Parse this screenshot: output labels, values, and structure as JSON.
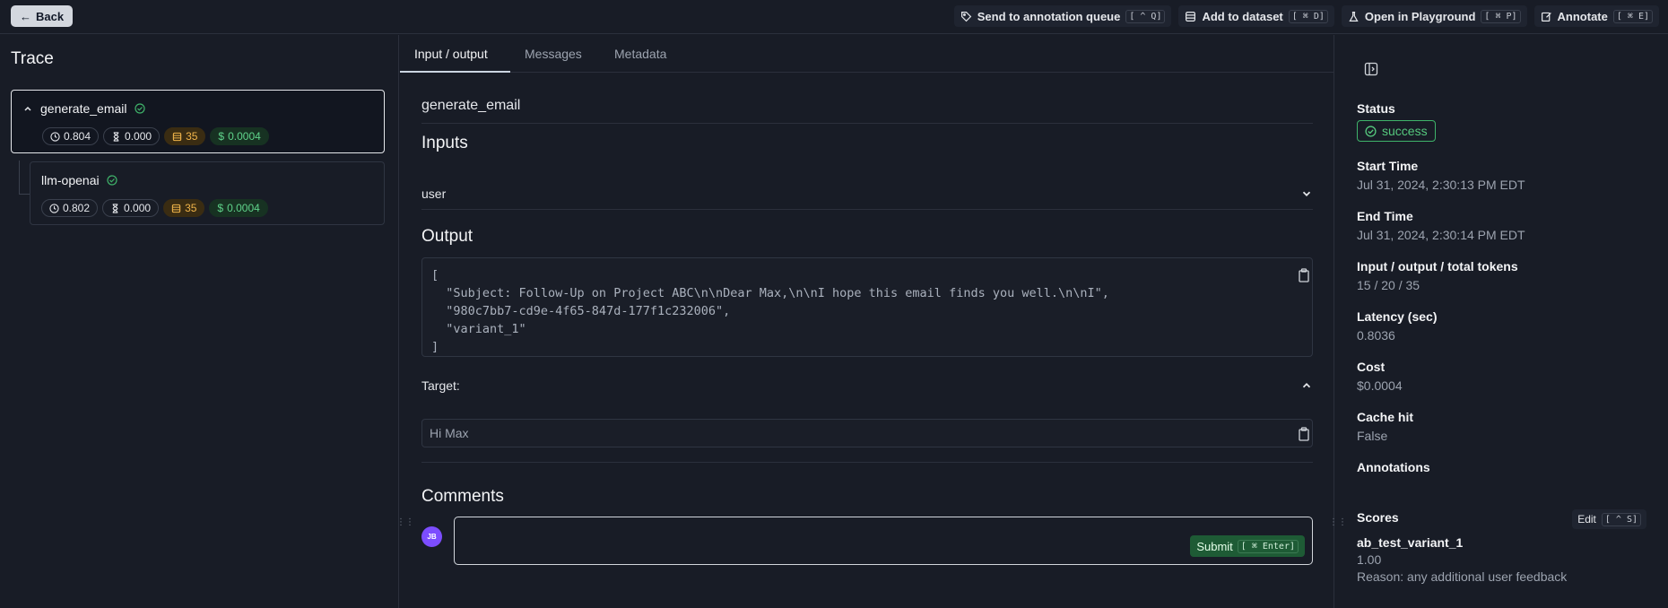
{
  "topbar": {
    "back_label": "Back",
    "actions": [
      {
        "label": "Send to annotation queue",
        "shortcut": "[ ^ Q]"
      },
      {
        "label": "Add to dataset",
        "shortcut": "[ ⌘ D]"
      },
      {
        "label": "Open in Playground",
        "shortcut": "[ ⌘ P]"
      },
      {
        "label": "Annotate",
        "shortcut": "[ ⌘ E]"
      }
    ]
  },
  "trace": {
    "title": "Trace",
    "nodes": [
      {
        "name": "generate_email",
        "latency": "0.804",
        "ttft": "0.000",
        "tokens": "35",
        "cost": "0.0004"
      },
      {
        "name": "llm-openai",
        "latency": "0.802",
        "ttft": "0.000",
        "tokens": "35",
        "cost": "0.0004"
      }
    ]
  },
  "tabs": [
    "Input / output",
    "Messages",
    "Metadata"
  ],
  "io": {
    "run_name": "generate_email",
    "inputs_title": "Inputs",
    "user_label": "user",
    "output_title": "Output",
    "output_code": "[\n  \"Subject: Follow-Up on Project ABC\\n\\nDear Max,\\n\\nI hope this email finds you well.\\n\\nI\",\n  \"980c7bb7-cd9e-4f65-847d-177f1c232006\",\n  \"variant_1\"\n]",
    "target_label": "Target:",
    "target_value": "Hi Max",
    "comments_title": "Comments",
    "avatar_initials": "JB",
    "submit_label": "Submit",
    "submit_shortcut": "[ ⌘ Enter]"
  },
  "details": {
    "status_label": "Status",
    "status_value": "success",
    "start_label": "Start Time",
    "start_value": "Jul 31, 2024, 2:30:13 PM EDT",
    "end_label": "End Time",
    "end_value": "Jul 31, 2024, 2:30:14 PM EDT",
    "tokens_label": "Input / output / total tokens",
    "tokens_value": "15 / 20 / 35",
    "latency_label": "Latency (sec)",
    "latency_value": "0.8036",
    "cost_label": "Cost",
    "cost_value": "$0.0004",
    "cache_label": "Cache hit",
    "cache_value": "False",
    "annotations_label": "Annotations",
    "scores_label": "Scores",
    "edit_label": "Edit",
    "edit_shortcut": "[ ^ S]",
    "score_name": "ab_test_variant_1",
    "score_value": "1.00",
    "score_reason": "Reason: any additional user feedback"
  },
  "colors": {
    "success": "#55c87d",
    "tokens": "#f0b44a",
    "cost": "#5fd38a",
    "avatar": "#7c4dff",
    "submit": "#1e5b35"
  }
}
